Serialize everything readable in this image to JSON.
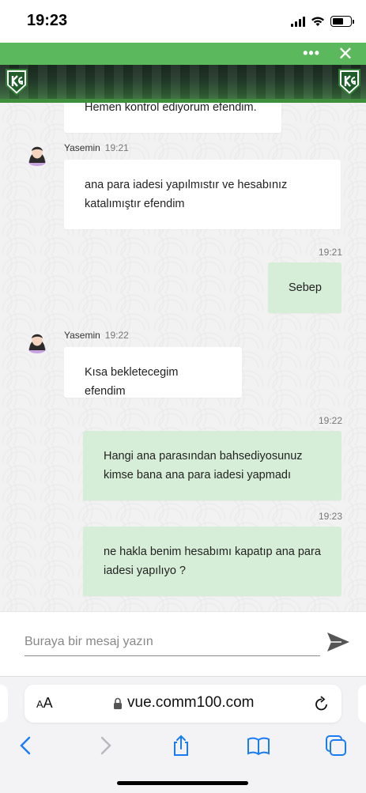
{
  "status_bar": {
    "time": "19:23"
  },
  "chat": {
    "messages": [
      {
        "dir": "in",
        "text": "Hemen kontrol ediyorum efendim."
      },
      {
        "dir": "in",
        "sender": "Yasemin",
        "time": "19:21",
        "text": "ana para iadesi yapılmıstır ve hesabınız katalımıştır efendim"
      },
      {
        "dir": "out",
        "time": "19:21",
        "text": "Sebep"
      },
      {
        "dir": "in",
        "sender": "Yasemin",
        "time": "19:22",
        "text": "Kısa bekletecegim efendim"
      },
      {
        "dir": "out",
        "time": "19:22",
        "text": "Hangi ana parasından bahsediyosunuz kimse bana ana para iadesi yapmadı"
      },
      {
        "dir": "out",
        "time": "19:23",
        "text": "ne hakla benim hesabımı kapatıp ana para iadesi yapılıyo ?"
      }
    ]
  },
  "composer": {
    "placeholder": "Buraya bir mesaj yazın"
  },
  "browser": {
    "aa_label_small": "A",
    "aa_label_large": "A",
    "url": "vue.comm100.com"
  },
  "colors": {
    "header_green": "#5cb85c",
    "outgoing_bubble": "#d6eed7",
    "incoming_bubble": "#ffffff",
    "ios_blue": "#1a7cf5"
  },
  "icons": [
    "more-icon",
    "close-icon",
    "logo-icon",
    "avatar-icon",
    "send-icon",
    "lock-icon",
    "reload-icon",
    "back-icon",
    "forward-icon",
    "share-icon",
    "bookmarks-icon",
    "tabs-icon"
  ]
}
